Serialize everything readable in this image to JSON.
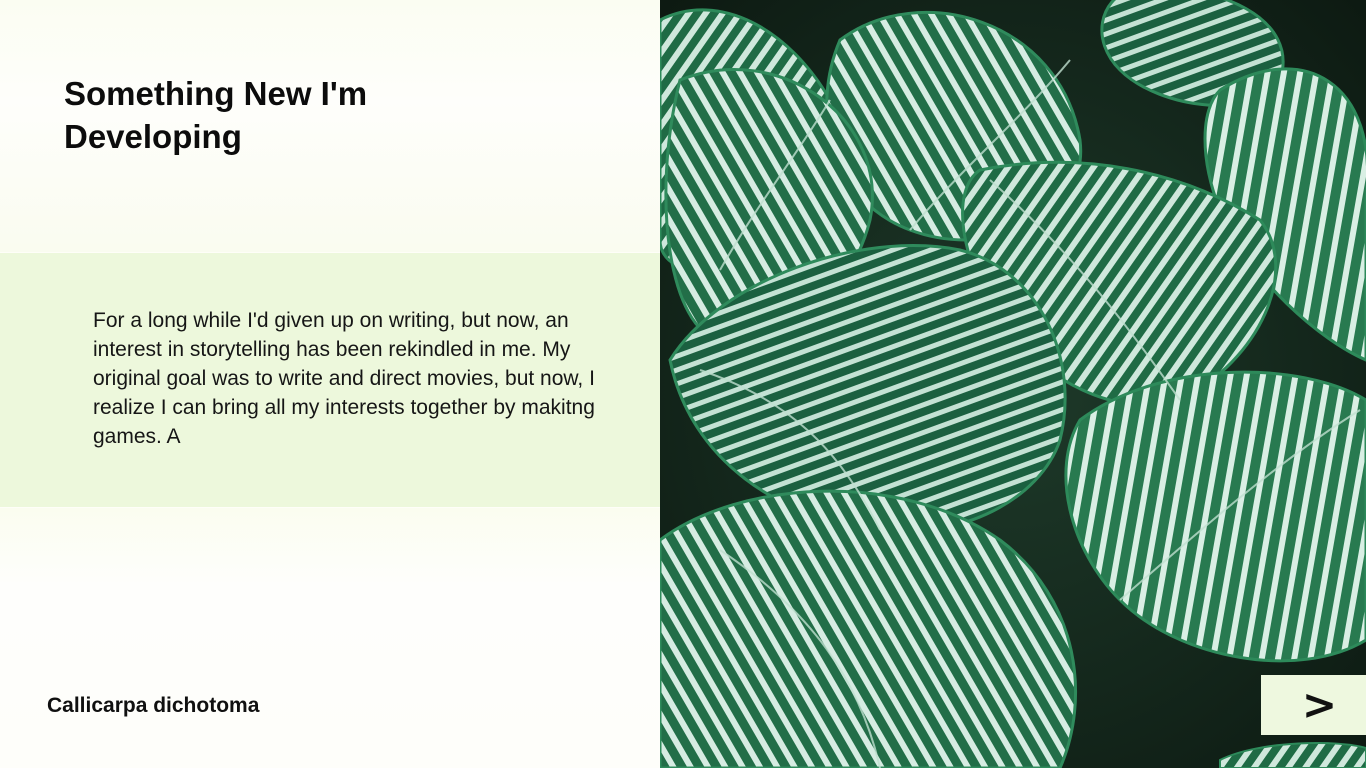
{
  "slide": {
    "title": "Something New I'm Developing",
    "body": "For a long while I'd given up on writing, but now, an interest in storytelling has been rekindled in me. My original goal was to write and direct movies, but now, I realize I can bring all my interests together by makitng games. A",
    "caption": "Callicarpa dichotoma",
    "next_label": ">"
  },
  "colors": {
    "background": "#fefef8",
    "band": "#edf8dc",
    "leaf_dark": "#1f6b45",
    "leaf_light": "#cfe8dc",
    "photo_shadow": "#14261c"
  },
  "icons": {
    "next": "chevron-right-icon"
  }
}
